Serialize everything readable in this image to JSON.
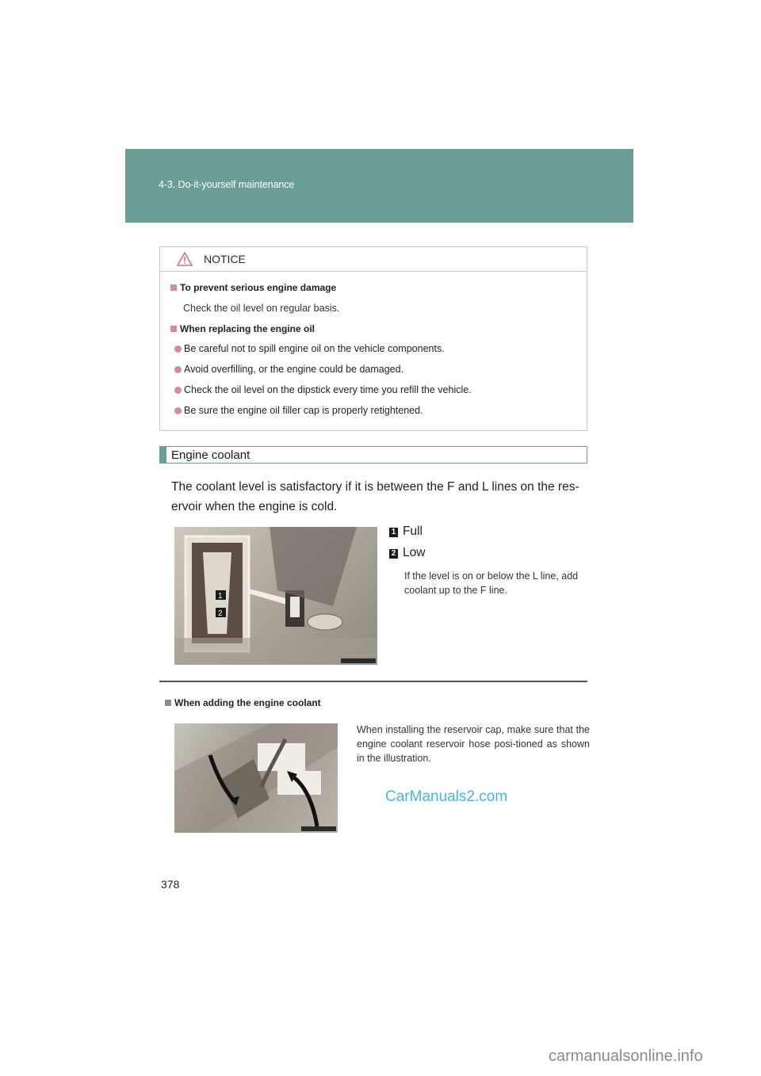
{
  "header": {
    "section_title": "4-3. Do-it-yourself maintenance",
    "band_color": "#6a9e94"
  },
  "notice": {
    "label": "NOTICE",
    "icon": "warning-triangle-icon",
    "accent_color": "#d68c96",
    "groups": [
      {
        "heading": "To prevent serious engine damage",
        "text": "Check the oil level on regular basis."
      },
      {
        "heading": "When replacing the engine oil",
        "bullets": [
          "Be careful not to spill engine oil on the vehicle components.",
          "Avoid overfilling, or the engine could be damaged.",
          "Check the oil level on the dipstick every time you refill the vehicle.",
          "Be sure the engine oil filler cap is properly retightened."
        ]
      }
    ]
  },
  "coolant": {
    "title": "Engine coolant",
    "paragraph": "The coolant level is satisfactory if it is between the F and L lines on the res-ervoir when the engine is cold.",
    "legend": [
      {
        "num": "1",
        "label": "Full"
      },
      {
        "num": "2",
        "label": "Low"
      }
    ],
    "note": "If the level is on or below the L line, add coolant up to the F line.",
    "image_labels": [
      "1",
      "2"
    ]
  },
  "adding": {
    "heading": "When adding the engine coolant",
    "note": "When installing the reservoir cap, make sure that the engine coolant reservoir hose posi-tioned as shown in the illustration."
  },
  "page_number": "378",
  "watermarks": {
    "blue": "CarManuals2.com",
    "grey": "carmanualsonline.info"
  }
}
